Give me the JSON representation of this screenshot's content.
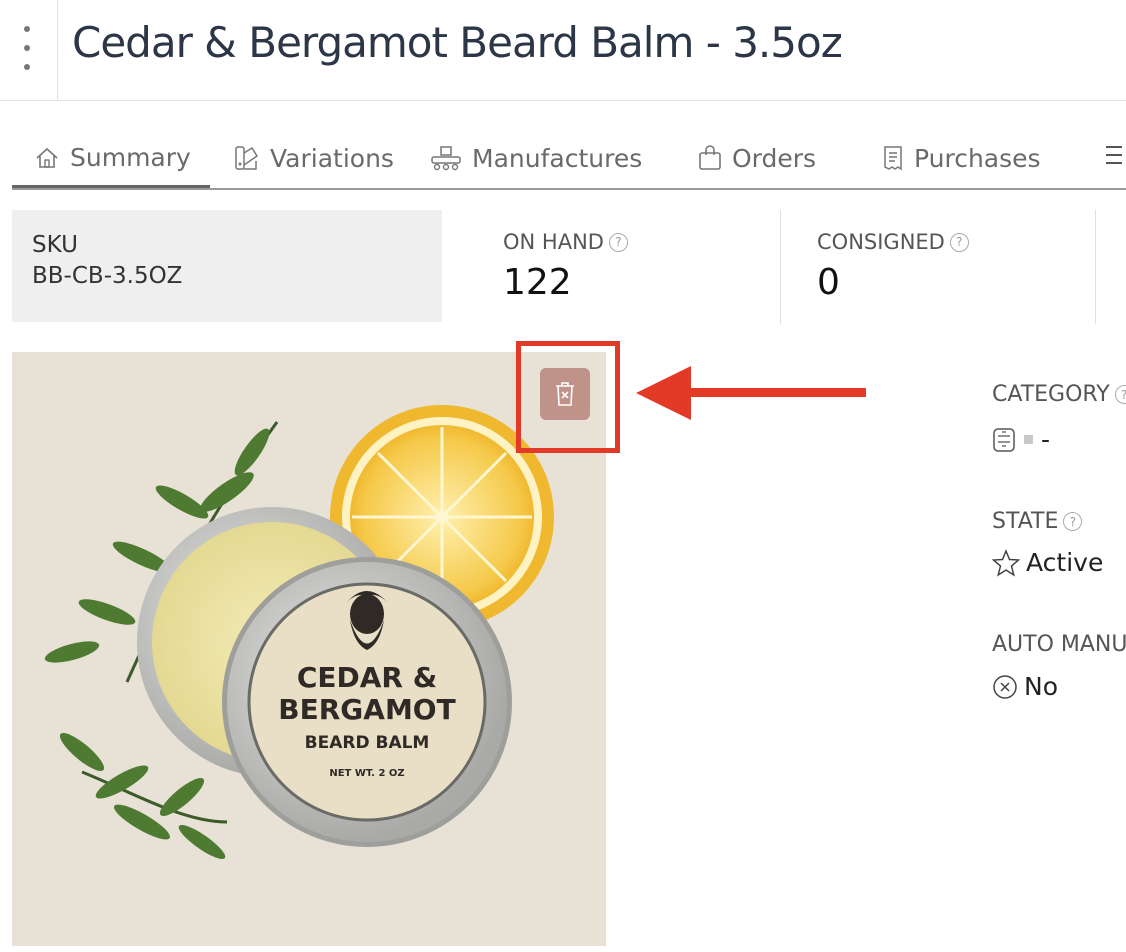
{
  "header": {
    "title": "Cedar & Bergamot Beard Balm - 3.5oz"
  },
  "tabs": [
    {
      "label": "Summary",
      "icon": "home-icon",
      "active": true
    },
    {
      "label": "Variations",
      "icon": "variations-icon"
    },
    {
      "label": "Manufactures",
      "icon": "manufacture-icon"
    },
    {
      "label": "Orders",
      "icon": "shopping-bag-icon"
    },
    {
      "label": "Purchases",
      "icon": "receipt-icon"
    }
  ],
  "sku": {
    "label": "SKU",
    "value": "BB-CB-3.5OZ"
  },
  "stats": [
    {
      "label": "ON HAND",
      "value": "122"
    },
    {
      "label": "CONSIGNED",
      "value": "0"
    }
  ],
  "image": {
    "lid_line1": "CEDAR &",
    "lid_line2": "BERGAMOT",
    "lid_line3": "BEARD BALM",
    "lid_line4": "NET WT. 2 OZ"
  },
  "details": {
    "category": {
      "label": "CATEGORY",
      "value": "-"
    },
    "state": {
      "label": "STATE",
      "value": "Active"
    },
    "auto_manufacture": {
      "label": "AUTO MANU",
      "value": "No"
    }
  },
  "colors": {
    "highlight": "#e23a26",
    "delete_button": "#bf928a",
    "title": "#2c3647"
  }
}
